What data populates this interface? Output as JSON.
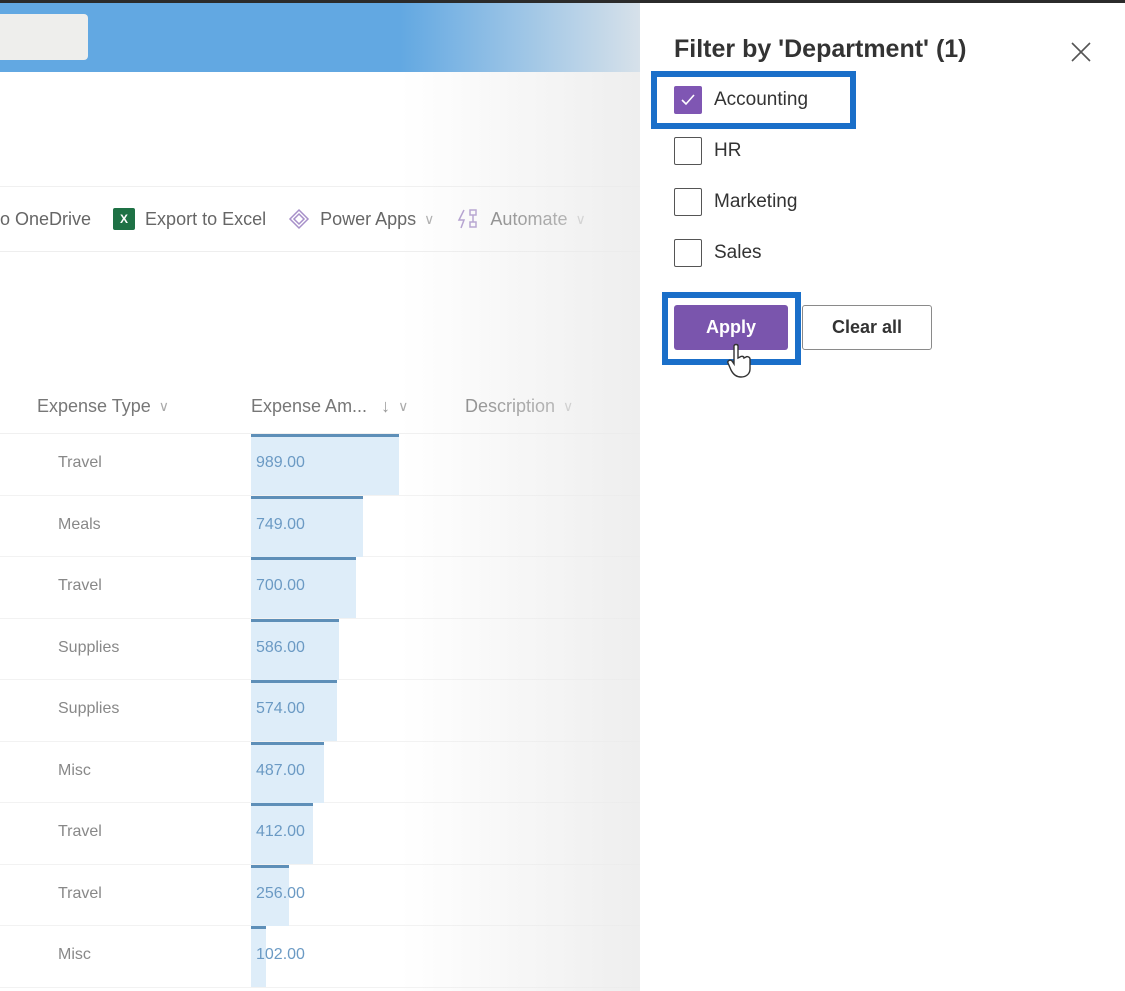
{
  "command_bar": {
    "items": [
      {
        "label": "o OneDrive",
        "icon": "onedrive-icon"
      },
      {
        "label": "Export to Excel",
        "icon": "excel-icon",
        "icon_text": "X"
      },
      {
        "label": "Power Apps",
        "icon": "power-apps-icon",
        "has_dropdown": true
      },
      {
        "label": "Automate",
        "icon": "automate-icon",
        "has_dropdown": true
      }
    ],
    "chevron": "∨"
  },
  "list": {
    "columns": [
      {
        "label": "Expense Type",
        "chevron": "∨"
      },
      {
        "label": "Expense Am...",
        "sort_indicator": "↓",
        "chevron": "∨"
      },
      {
        "label": "Description",
        "chevron": "∨"
      }
    ],
    "max_amount": 989,
    "rows": [
      {
        "type": "Travel",
        "amount": "989.00",
        "value": 989
      },
      {
        "type": "Meals",
        "amount": "749.00",
        "value": 749
      },
      {
        "type": "Travel",
        "amount": "700.00",
        "value": 700
      },
      {
        "type": "Supplies",
        "amount": "586.00",
        "value": 586
      },
      {
        "type": "Supplies",
        "amount": "574.00",
        "value": 574
      },
      {
        "type": "Misc",
        "amount": "487.00",
        "value": 487
      },
      {
        "type": "Travel",
        "amount": "412.00",
        "value": 412
      },
      {
        "type": "Travel",
        "amount": "256.00",
        "value": 256
      },
      {
        "type": "Misc",
        "amount": "102.00",
        "value": 102
      }
    ]
  },
  "filter_panel": {
    "title": "Filter by 'Department' (1)",
    "options": [
      {
        "label": "Accounting",
        "checked": true
      },
      {
        "label": "HR",
        "checked": false
      },
      {
        "label": "Marketing",
        "checked": false
      },
      {
        "label": "Sales",
        "checked": false
      }
    ],
    "apply_label": "Apply",
    "clear_label": "Clear all"
  },
  "colors": {
    "suite_bar": "#62a8e2",
    "accent_purple": "#7a55ad",
    "highlight_blue": "#1a6fc9",
    "data_bar": "#deedf9"
  }
}
